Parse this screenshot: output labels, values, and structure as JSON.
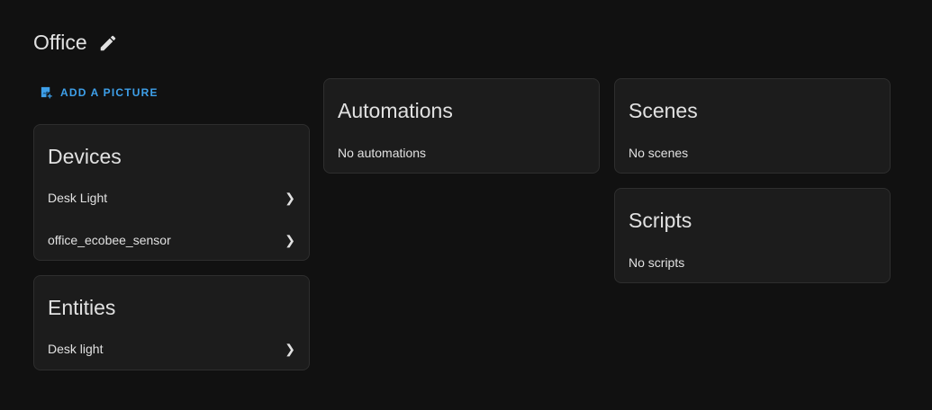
{
  "header": {
    "title": "Office",
    "edit_icon": "pencil-icon"
  },
  "add_picture": {
    "label": "ADD A PICTURE",
    "icon": "image-plus-icon",
    "color": "#3ea0ea"
  },
  "devices": {
    "title": "Devices",
    "items": [
      {
        "label": "Desk Light"
      },
      {
        "label": "office_ecobee_sensor"
      }
    ]
  },
  "entities": {
    "title": "Entities",
    "items": [
      {
        "label": "Desk light"
      }
    ]
  },
  "automations": {
    "title": "Automations",
    "empty": "No automations"
  },
  "scenes": {
    "title": "Scenes",
    "empty": "No scenes"
  },
  "scripts": {
    "title": "Scripts",
    "empty": "No scripts"
  }
}
